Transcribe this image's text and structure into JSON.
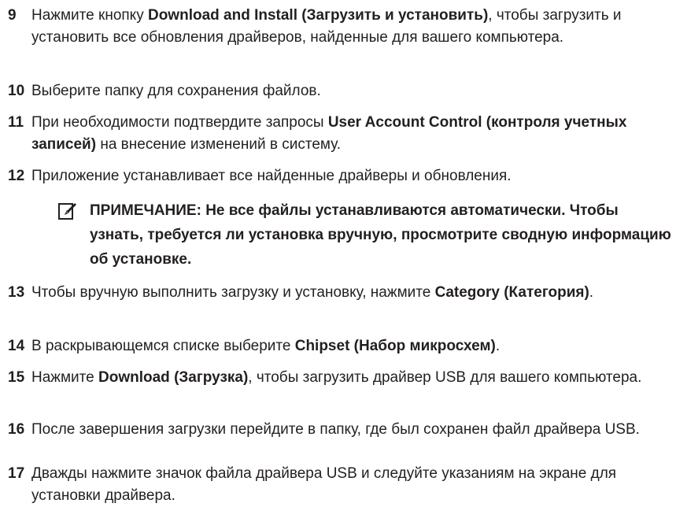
{
  "steps": [
    {
      "num": "9",
      "a": "Нажмите кнопку ",
      "b": "Download and Install (Загрузить и установить)",
      "c": ", чтобы загрузить и установить все обновления драйверов, найденные для вашего компьютера."
    },
    {
      "num": "10",
      "a": "Выберите папку для сохранения файлов."
    },
    {
      "num": "11",
      "a": "При необходимости подтвердите запросы ",
      "b": "User Account Control (контроля учетных записей)",
      "c": " на внесение изменений в систему."
    },
    {
      "num": "12",
      "a": "Приложение устанавливает все найденные драйверы и обновления."
    },
    {
      "num": "13",
      "a": "Чтобы вручную выполнить загрузку и установку, нажмите ",
      "b": "Category (Категория)",
      "c": "."
    },
    {
      "num": "14",
      "a": "В раскрывающемся списке выберите ",
      "b": "Chipset (Набор микросхем)",
      "c": "."
    },
    {
      "num": "15",
      "a": "Нажмите ",
      "b": "Download (Загрузка)",
      "c": ", чтобы загрузить драйвер ",
      "d": "USB",
      "e": " для вашего компьютера."
    },
    {
      "num": "16",
      "a": "После завершения загрузки перейдите в папку, где был сохранен файл драйвера ",
      "d": "USB",
      "e": "."
    },
    {
      "num": "17",
      "a": "Дважды нажмите значок файла драйвера ",
      "d": "USB",
      "e": " и следуйте указаниям на экране для установки драйвера."
    }
  ],
  "note": {
    "text": "ПРИМЕЧАНИЕ: Не все файлы устанавливаются автоматически. Чтобы узнать, требуется ли установка вручную, просмотрите сводную информацию об установке.",
    "icon": "pencil-note-icon"
  },
  "colors": {
    "text": "#231f20"
  }
}
